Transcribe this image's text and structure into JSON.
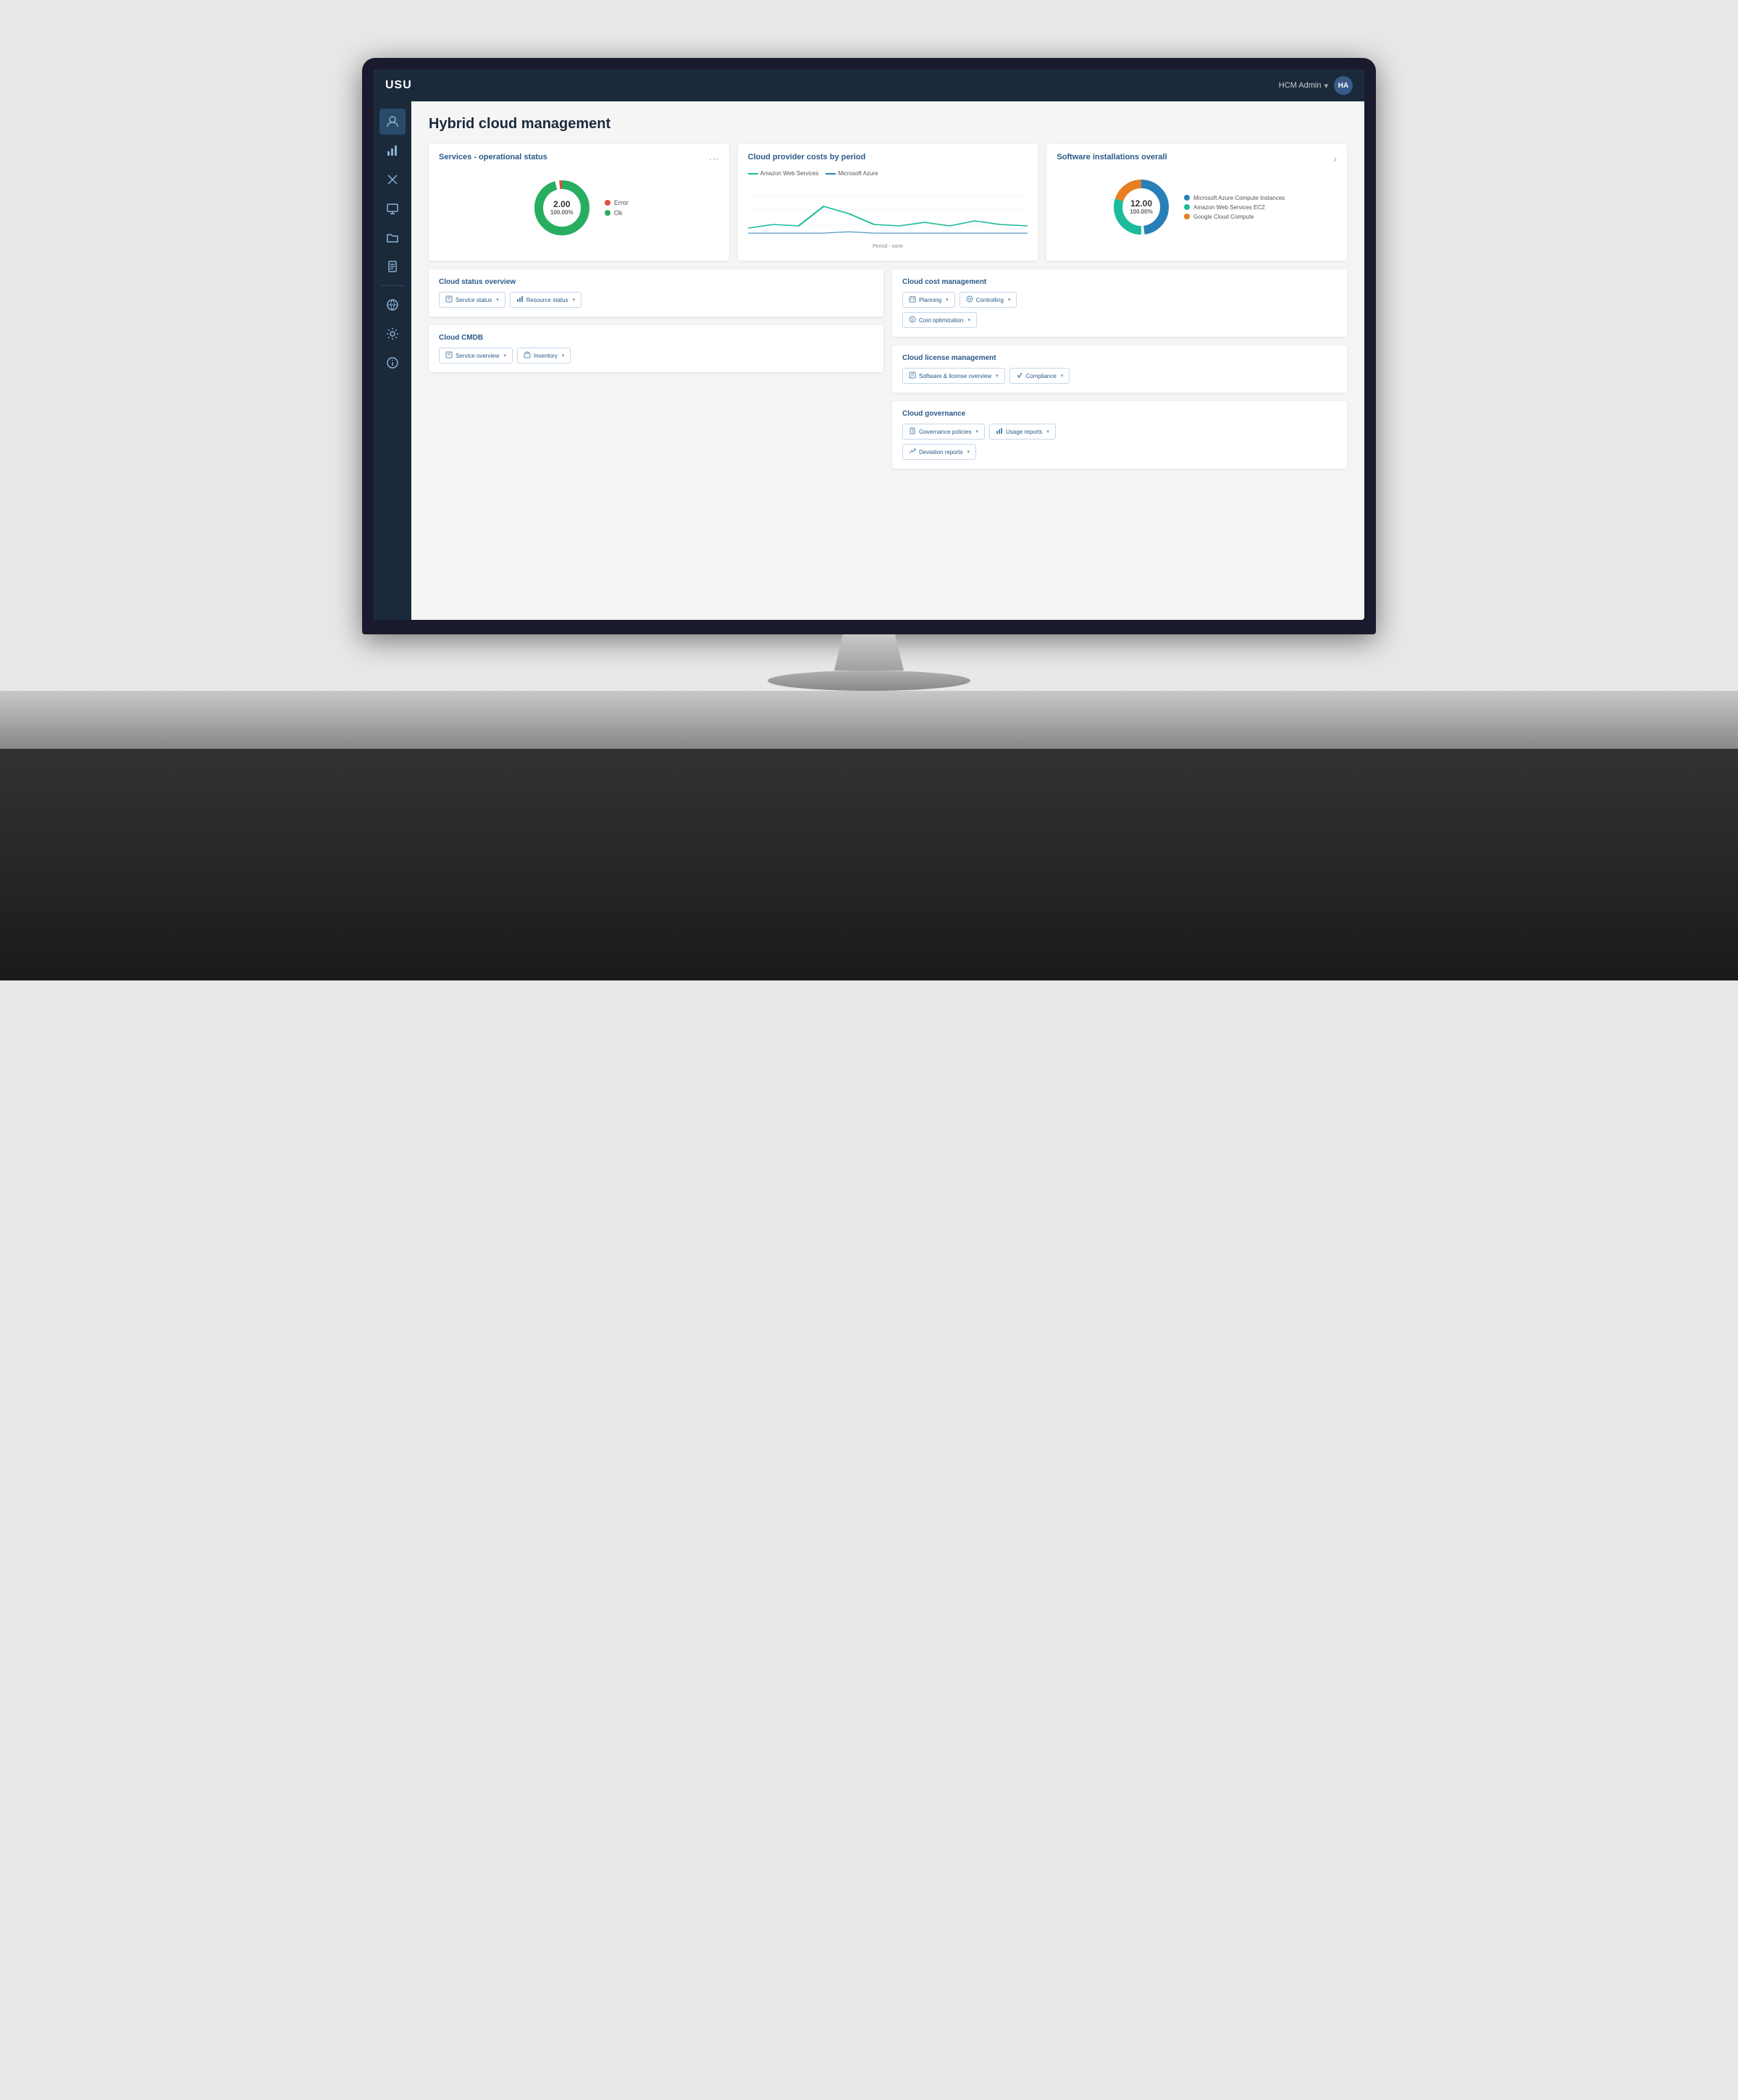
{
  "app": {
    "logo": "USU",
    "user": "HCM Admin",
    "user_initials": "HA",
    "page_title": "Hybrid cloud management"
  },
  "sidebar": {
    "icons": [
      {
        "name": "user-icon",
        "symbol": "👤",
        "active": true
      },
      {
        "name": "chart-icon",
        "symbol": "📊",
        "active": false
      },
      {
        "name": "tools-icon",
        "symbol": "✂",
        "active": false
      },
      {
        "name": "monitor-icon",
        "symbol": "🖥",
        "active": false
      },
      {
        "name": "folder-icon",
        "symbol": "📁",
        "active": false
      },
      {
        "name": "document-icon",
        "symbol": "📄",
        "active": false
      },
      {
        "name": "network-icon",
        "symbol": "⚙",
        "active": false
      },
      {
        "name": "settings-icon",
        "symbol": "⚙",
        "active": false
      },
      {
        "name": "info-icon",
        "symbol": "ℹ",
        "active": false
      }
    ]
  },
  "cards": {
    "services_status": {
      "title": "Services - operational status",
      "value": "2.00",
      "percent": "100.00%",
      "legend": [
        {
          "label": "Error",
          "color": "#e74c3c",
          "value": 2
        },
        {
          "label": "Ok",
          "color": "#27ae60",
          "value": 98
        }
      ]
    },
    "cloud_provider_costs": {
      "title": "Cloud provider costs by period",
      "legend": [
        {
          "label": "Amazon Web Services",
          "color": "#1abc9c"
        },
        {
          "label": "Microsoft Azure",
          "color": "#2980b9"
        }
      ],
      "x_label": "Period - none",
      "data_aws": [
        5,
        8,
        6,
        18,
        12,
        8,
        6,
        9,
        7,
        10,
        8,
        6
      ],
      "data_azure": [
        2,
        2,
        2,
        2,
        3,
        2,
        2,
        2,
        2,
        2,
        2,
        2
      ]
    },
    "software_installations": {
      "title": "Software installations overall",
      "value": "12.00",
      "percent": "100.00%",
      "legend": [
        {
          "label": "Microsoft Azure Compute Instances",
          "color": "#2980b9",
          "value": 50
        },
        {
          "label": "Amazon Web Services EC2",
          "color": "#1abc9c",
          "value": 30
        },
        {
          "label": "Google Cloud Compute",
          "color": "#e67e22",
          "value": 20
        }
      ]
    }
  },
  "sections": {
    "cloud_status_overview": {
      "title": "Cloud status overview",
      "buttons": [
        {
          "label": "Service status",
          "icon": "📋"
        },
        {
          "label": "Resource status",
          "icon": "📊"
        }
      ]
    },
    "cloud_cost_management": {
      "title": "Cloud cost management",
      "buttons": [
        {
          "label": "Planning",
          "icon": "📅"
        },
        {
          "label": "Controlling",
          "icon": "⚙"
        },
        {
          "label": "Cost optimization",
          "icon": "💰"
        }
      ]
    },
    "cloud_license_management": {
      "title": "Cloud license management",
      "buttons": [
        {
          "label": "Software & license overview",
          "icon": "📄"
        },
        {
          "label": "Compliance",
          "icon": "✅"
        }
      ]
    },
    "cloud_cmdb": {
      "title": "Cloud CMDB",
      "buttons": [
        {
          "label": "Service overview",
          "icon": "📋"
        },
        {
          "label": "Inventory",
          "icon": "📦"
        }
      ]
    },
    "cloud_governance": {
      "title": "Cloud governance",
      "buttons": [
        {
          "label": "Governance policies",
          "icon": "📜"
        },
        {
          "label": "Usage reports",
          "icon": "📊"
        },
        {
          "label": "Deviation reports",
          "icon": "📉"
        }
      ]
    }
  }
}
